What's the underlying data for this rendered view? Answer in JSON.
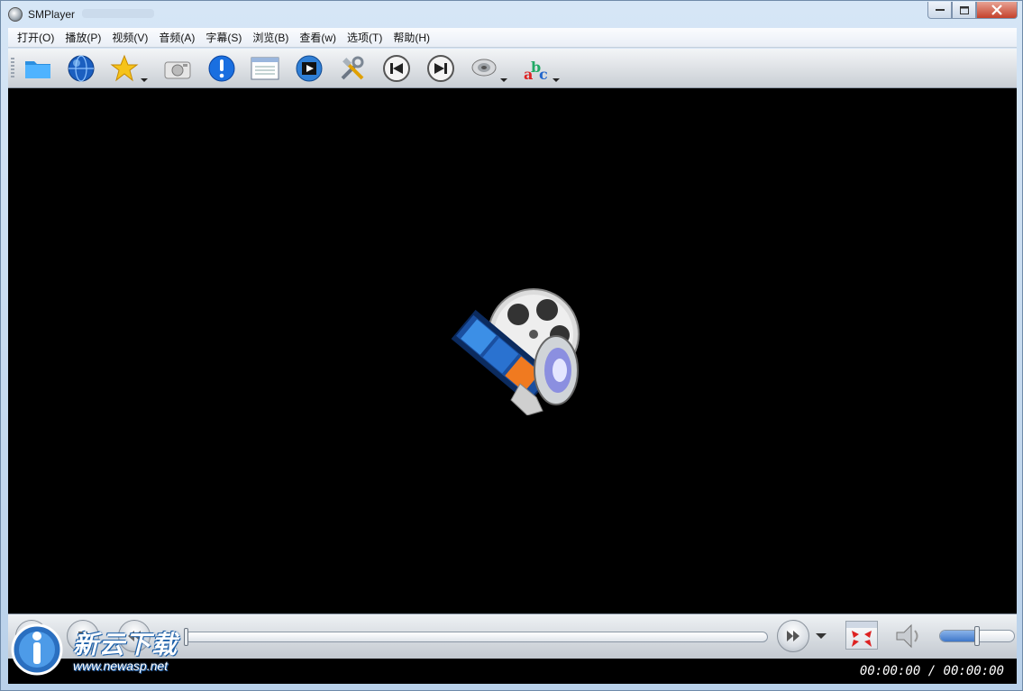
{
  "window": {
    "title": "SMPlayer",
    "app_icon": "smplayer-icon",
    "controls": [
      "minimize-icon",
      "maximize-icon",
      "close-icon"
    ]
  },
  "menu": {
    "items": [
      {
        "label": "打开(O)"
      },
      {
        "label": "播放(P)"
      },
      {
        "label": "视频(V)"
      },
      {
        "label": "音频(A)"
      },
      {
        "label": "字幕(S)"
      },
      {
        "label": "浏览(B)"
      },
      {
        "label": "查看(w)"
      },
      {
        "label": "选项(T)"
      },
      {
        "label": "帮助(H)"
      }
    ]
  },
  "toolbar": {
    "icons": [
      "folder-icon",
      "globe-icon",
      "favorites-star-icon",
      "screenshot-camera-icon",
      "info-icon",
      "playlist-icon",
      "video-equalizer-icon",
      "preferences-tools-icon",
      "previous-icon",
      "next-icon",
      "audio-track-icon",
      "subtitles-abc-icon"
    ]
  },
  "controls": {
    "buttons": [
      "play-icon",
      "stop-icon",
      "rewind-icon",
      "forward-icon",
      "fullscreen-icon",
      "volume-icon"
    ],
    "volume_level": 0.5
  },
  "status": {
    "time": "00:00:00 / 00:00:00"
  },
  "watermark": {
    "cn_text": "新云下载",
    "url": "www.newasp.net"
  },
  "colors": {
    "video_bg": "#000000",
    "title_bar": "#c9dcf0",
    "close_button": "#c4412b",
    "volume_fill": "#3f77c9"
  }
}
